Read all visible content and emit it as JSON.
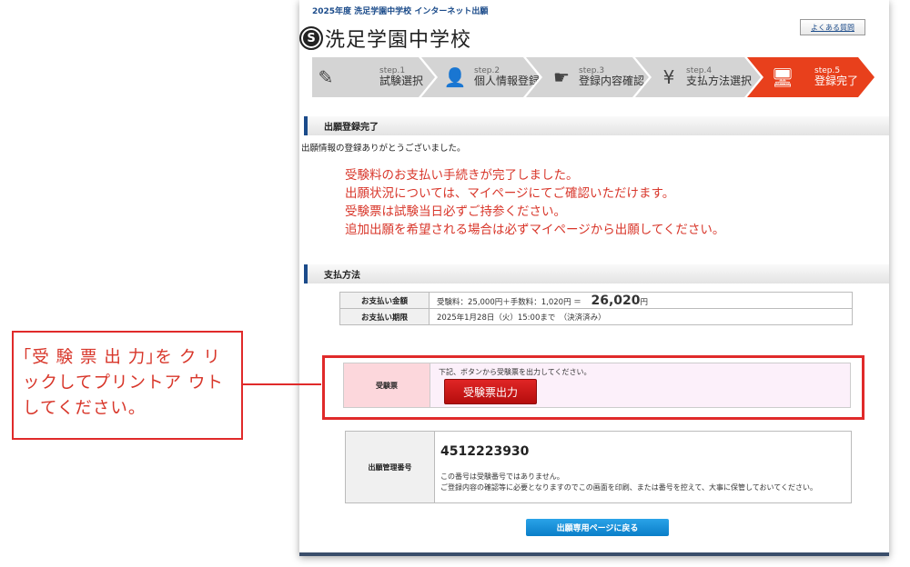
{
  "header": {
    "top_line": "2025年度 洗足学園中学校 インターネット出願",
    "logo_emblem": "S",
    "school_name": "洗足学園中学校",
    "faq_label": "よくある質問"
  },
  "steps": [
    {
      "num": "step.1",
      "label": "試験選択",
      "icon": "pencil-icon",
      "glyph": "✎"
    },
    {
      "num": "step.2",
      "label": "個人情報登録",
      "icon": "person-icon",
      "glyph": "👤"
    },
    {
      "num": "step.3",
      "label": "登録内容確認",
      "icon": "pointer-icon",
      "glyph": "☛"
    },
    {
      "num": "step.4",
      "label": "支払方法選択",
      "icon": "yen-icon",
      "glyph": "¥"
    },
    {
      "num": "step.5",
      "label": "登録完了",
      "icon": "computer-icon",
      "glyph": "🖥"
    }
  ],
  "colors": {
    "active_step": "#e8401c",
    "inactive_step": "#d4d4d4",
    "accent_red": "#d8362a",
    "button_blue": "#0a7ec8"
  },
  "completion": {
    "heading": "出願登録完了",
    "thanks": "出願情報の登録ありがとうございました。",
    "notices": [
      "受験料のお支払い手続きが完了しました。",
      "出願状況については、マイページにてご確認いただけます。",
      "受験票は試験当日必ずご持参ください。",
      "追加出願を希望される場合は必ずマイページから出願してください。"
    ]
  },
  "payment": {
    "heading": "支払方法",
    "amount_label": "お支払い金額",
    "amount_detail": "受験料：25,000円＋手数料：1,020円 ＝",
    "amount_total": "26,020",
    "amount_unit": "円",
    "deadline_label": "お支払い期限",
    "deadline_value": "2025年1月28日（火）15:00まで　（決済済み）"
  },
  "ticket": {
    "label": "受験票",
    "desc": "下記、ボタンから受験票を出力してください。",
    "button": "受験票出力"
  },
  "management": {
    "label": "出願管理番号",
    "number": "4512223930",
    "note1": "この番号は受験番号ではありません。",
    "note2": "ご登録内容の確認等に必要となりますのでこの画面を印刷、または番号を控えて、大事に保管しておいてください。"
  },
  "back_button": "出願専用ページに戻る",
  "callout": {
    "text": "｢受 験 票 出 力｣を ク リックしてプリントア ウトしてください。"
  }
}
